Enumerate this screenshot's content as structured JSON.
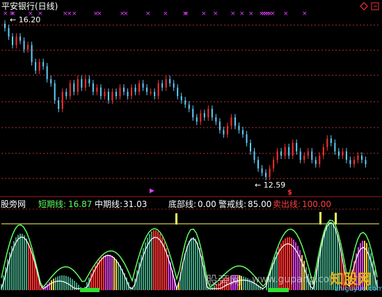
{
  "header": {
    "title": "平安银行(日线)"
  },
  "price_panel": {
    "high_label": "16.20",
    "low_label": "12.59"
  },
  "indicator": {
    "name": "股旁网",
    "short_label": "短期线:",
    "short_value": "16.87",
    "mid_label": "中期线:",
    "mid_value": "31.03",
    "bottom_label": "底部线:",
    "bottom_value": "0.00",
    "alert_label": "警戒线:",
    "alert_value": "85.00",
    "sell_label": "卖出线:",
    "sell_value": "100.00"
  },
  "watermark": {
    "left_text": "股旁网",
    "url_text": "www.gupang.com",
    "logo_text": "知股网",
    "logo_sub": "zhiguyue.com"
  },
  "colors": {
    "up": "#ff3030",
    "down": "#60d0ff",
    "short_line": "#60ff60",
    "mid_line": "#ffffff",
    "alert": "#ffff60",
    "sell": "#ff4040",
    "magenta_marker": "#e040ff",
    "grid": "#c03030"
  },
  "chart_data": {
    "type": "candlestick",
    "title": "平安银行(日线)",
    "price_high": 16.2,
    "price_low": 12.59,
    "closes": [
      16.1,
      15.9,
      15.7,
      15.9,
      15.8,
      15.6,
      15.7,
      15.3,
      15.1,
      15.3,
      15.2,
      14.9,
      14.8,
      14.4,
      14.2,
      14.6,
      14.5,
      14.8,
      14.6,
      14.9,
      14.7,
      14.9,
      14.8,
      14.6,
      14.7,
      14.5,
      14.6,
      14.4,
      14.6,
      14.5,
      14.7,
      14.6,
      14.5,
      14.7,
      14.6,
      14.8,
      14.7,
      14.6,
      14.6,
      14.5,
      14.8,
      14.7,
      14.9,
      14.8,
      14.7,
      14.5,
      14.4,
      14.3,
      14.2,
      14.0,
      13.9,
      14.1,
      14.0,
      14.2,
      14.0,
      13.9,
      13.7,
      13.6,
      13.8,
      14.0,
      13.8,
      13.7,
      13.6,
      13.4,
      13.2,
      13.0,
      12.8,
      12.7,
      12.6,
      12.8,
      13.0,
      13.2,
      13.1,
      13.3,
      13.1,
      13.4,
      13.2,
      13.0,
      13.1,
      13.2,
      13.0,
      12.9,
      13.1,
      13.3,
      13.5,
      13.4,
      13.2,
      13.1,
      13.2,
      13.0,
      12.9,
      13.0,
      13.1,
      13.0,
      12.9
    ],
    "indicator": {
      "short_line": 16.87,
      "mid_line": 31.03,
      "bottom_line": 0.0,
      "alert_line": 85.0,
      "sell_line": 100.0
    }
  }
}
